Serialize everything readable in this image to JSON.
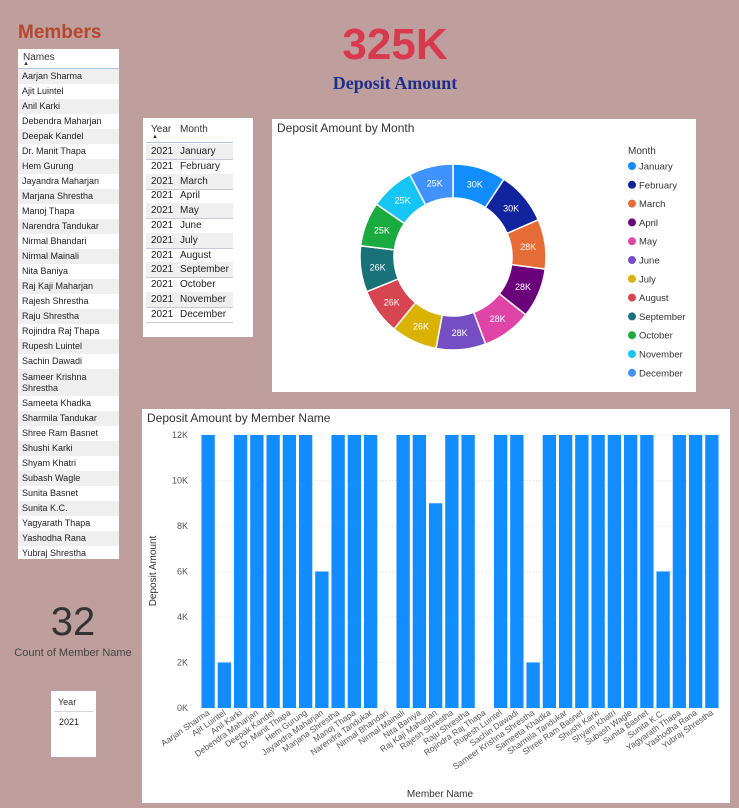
{
  "members": {
    "title": "Members",
    "column_header": "Names",
    "sort_indicator": "▲",
    "names": [
      "Aarjan Sharma",
      "Ajit Luintel",
      "Anil Karki",
      "Debendra Maharjan",
      "Deepak Kandel",
      "Dr. Manit Thapa",
      "Hem Gurung",
      "Jayandra Maharjan",
      "Marjana Shrestha",
      "Manoj Thapa",
      "Narendra Tandukar",
      "Nirmal Bhandari",
      "Nirmal Mainali",
      "Nita Baniya",
      "Raj Kaji Maharjan",
      "Rajesh Shrestha",
      "Raju Shrestha",
      "Rojindra Raj Thapa",
      "Rupesh Luintel",
      "Sachin Dawadi",
      "Sameer Krishna Shrestha",
      "Sameeta Khadka",
      "Sharmila Tandukar",
      "Shree Ram Basnet",
      "Shushi Karki",
      "Shyam Khatri",
      "Subash Wagle",
      "Sunita Basnet",
      "Sunita K.C.",
      "Yagyarath Thapa",
      "Yashodha Rana",
      "Yubraj Shrestha"
    ]
  },
  "kpi": {
    "value": "325K",
    "label": "Deposit Amount"
  },
  "year_month_table": {
    "headers": [
      "Year",
      "Month"
    ],
    "sort_indicator": "▲",
    "rows": [
      [
        "2021",
        "January"
      ],
      [
        "2021",
        "February"
      ],
      [
        "2021",
        "March"
      ],
      [
        "2021",
        "April"
      ],
      [
        "2021",
        "May"
      ],
      [
        "2021",
        "June"
      ],
      [
        "2021",
        "July"
      ],
      [
        "2021",
        "August"
      ],
      [
        "2021",
        "September"
      ],
      [
        "2021",
        "October"
      ],
      [
        "2021",
        "November"
      ],
      [
        "2021",
        "December"
      ]
    ]
  },
  "count_card": {
    "value": "32",
    "label": "Count of Member Name"
  },
  "year_slicer": {
    "header": "Year",
    "value": "2021"
  },
  "chart_data": [
    {
      "type": "pie",
      "title": "Deposit Amount by Month",
      "legend_title": "Month",
      "legend_position": "right",
      "categories": [
        "January",
        "February",
        "March",
        "April",
        "May",
        "June",
        "July",
        "August",
        "September",
        "October",
        "November",
        "December"
      ],
      "values": [
        30000,
        30000,
        28000,
        28000,
        28000,
        28000,
        26000,
        26000,
        26000,
        25000,
        25000,
        25000
      ],
      "labels": [
        "30K",
        "30K",
        "28K",
        "28K",
        "28K",
        "28K",
        "26K",
        "26K",
        "26K",
        "25K",
        "25K",
        "25K"
      ],
      "colors": [
        "#118dff",
        "#12239e",
        "#e66c37",
        "#6b007b",
        "#e044a7",
        "#744ec2",
        "#d9b300",
        "#d64550",
        "#197278",
        "#1aab40",
        "#15c6f4",
        "#4092ff"
      ]
    },
    {
      "type": "bar",
      "title": "Deposit Amount by Member Name",
      "xlabel": "Member Name",
      "ylabel": "Deposit Amount",
      "ylim": [
        0,
        12000
      ],
      "yticks": [
        0,
        2000,
        4000,
        6000,
        8000,
        10000,
        12000
      ],
      "ytick_labels": [
        "0K",
        "2K",
        "4K",
        "6K",
        "8K",
        "10K",
        "12K"
      ],
      "grid": true,
      "bar_color": "#118dff",
      "categories": [
        "Aarjan Sharma",
        "Ajit Luintel",
        "Anil Karki",
        "Debendra Maharjan",
        "Deepak Kandel",
        "Dr. Manit Thapa",
        "Hem Gurung",
        "Jayandra Maharjan",
        "Marjana Shrestha",
        "Manoj Thapa",
        "Narendra Tandukar",
        "Nirmal Bhandari",
        "Nirmal Mainali",
        "Nita Baniya",
        "Raj Kaji Maharjan",
        "Rajesh Shrestha",
        "Raju Shrestha",
        "Rojindra Raj Thapa",
        "Rupesh Luintel",
        "Sachin Dawadi",
        "Sameer Krishna Shrestha",
        "Sameeta Khadka",
        "Sharmila Tandukar",
        "Shree Ram Basnet",
        "Shushi Karki",
        "Shyam Khatri",
        "Subash Wagle",
        "Sunita Basnet",
        "Sunita K.C.",
        "Yagyarath Thapa",
        "Yashodha Rana",
        "Yubraj Shrestha"
      ],
      "values": [
        12000,
        2000,
        12000,
        12000,
        12000,
        12000,
        12000,
        6000,
        12000,
        12000,
        12000,
        0,
        12000,
        12000,
        9000,
        12000,
        12000,
        0,
        12000,
        12000,
        2000,
        12000,
        12000,
        12000,
        12000,
        12000,
        12000,
        12000,
        6000,
        12000,
        12000,
        12000,
        12000
      ]
    }
  ]
}
